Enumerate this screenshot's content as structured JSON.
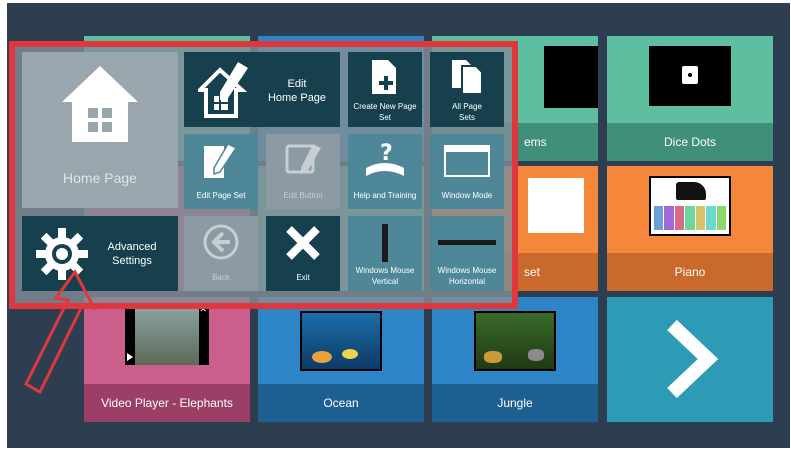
{
  "tiles": {
    "items_partial": "ems",
    "dice_dots": "Dice Dots",
    "drum_partial": "set",
    "piano": "Piano",
    "video_elephants": "Video Player - Elephants",
    "ocean": "Ocean",
    "jungle": "Jungle"
  },
  "menu": {
    "home_page": "Home Page",
    "edit_home_page_line1": "Edit",
    "edit_home_page_line2": "Home Page",
    "create_new_page_set_line1": "Create New Page",
    "create_new_page_set_line2": "Set",
    "all_page_sets_line1": "All Page",
    "all_page_sets_line2": "Sets",
    "edit_page_set": "Edit Page Set",
    "edit_button": "Edit Button",
    "help_and_training": "Help and Training",
    "window_mode": "Window Mode",
    "advanced_settings_line1": "Advanced",
    "advanced_settings_line2": "Settings",
    "back": "Back",
    "exit": "Exit",
    "windows_mouse_vertical_line1": "Windows Mouse",
    "windows_mouse_vertical_line2": "Vertical",
    "windows_mouse_horizontal_line1": "Windows Mouse",
    "windows_mouse_horizontal_line2": "Horizontal"
  },
  "colors": {
    "background": "#2d3e50",
    "menu_button": "#17404f",
    "highlight_border": "#e0373d",
    "arrow": "#e0373d",
    "tile_teal": "#5dbf9f",
    "tile_orange": "#f5873a",
    "tile_pink": "#c95f8a",
    "tile_blue": "#2d84c6"
  },
  "icons": [
    "house-icon",
    "edit-home-icon",
    "new-page-icon",
    "all-pages-icon",
    "edit-page-icon",
    "edit-button-icon",
    "help-icon",
    "window-icon",
    "gear-icon",
    "back-icon",
    "close-icon",
    "mouse-vertical-icon",
    "mouse-horizontal-icon",
    "next-arrow-icon",
    "pointer-arrow"
  ]
}
